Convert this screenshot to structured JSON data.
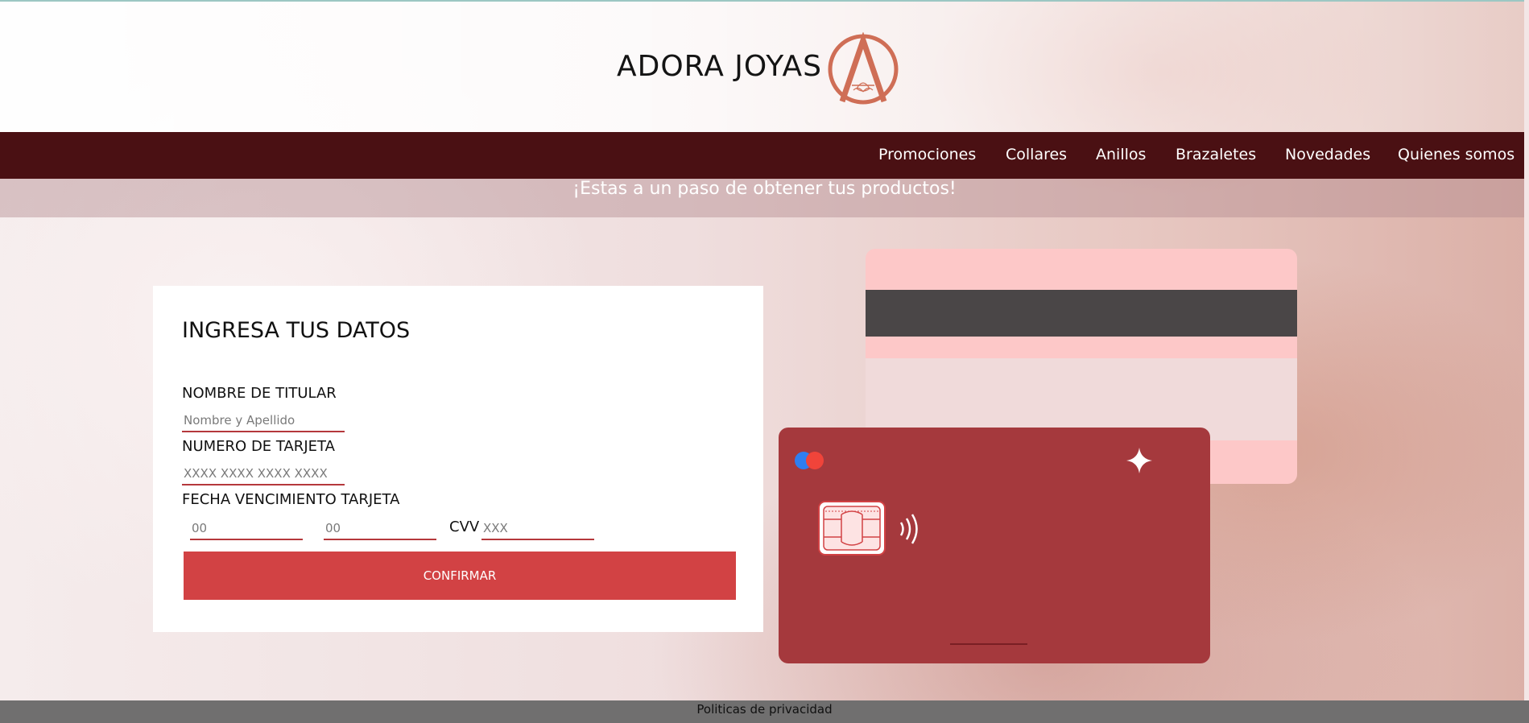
{
  "brand": {
    "name": "ADORA JOYAS",
    "logo_icon": "letter-a-lotus-logo",
    "accent": "#cf6e56"
  },
  "nav": {
    "items": [
      {
        "label": "Promociones"
      },
      {
        "label": "Collares"
      },
      {
        "label": "Anillos"
      },
      {
        "label": "Brazaletes"
      },
      {
        "label": "Novedades"
      },
      {
        "label": "Quienes somos"
      }
    ]
  },
  "banner": {
    "text": "¡Estas a un paso de obtener tus productos!"
  },
  "form": {
    "title": "INGRESA TUS DATOS",
    "holder_label": "NOMBRE DE TITULAR",
    "holder_placeholder": "Nombre y Apellido",
    "number_label": "NUMERO DE TARJETA",
    "number_placeholder": "XXXX XXXX XXXX XXXX",
    "expiry_label": "FECHA VENCIMIENTO TARJETA",
    "month_placeholder": "00",
    "year_placeholder": "00",
    "cvv_label": "CVV",
    "cvv_placeholder": "XXX",
    "confirm_label": "CONFIRMAR"
  },
  "card": {
    "brand_icon": "mastercard-circles-icon",
    "chip_icon": "chip-icon",
    "contactless_icon": "contactless-icon",
    "sparkle_icon": "sparkle-icon"
  },
  "footer": {
    "text": "Politicas de privacidad"
  },
  "colors": {
    "nav_bg": "#4a1013",
    "button": "#d24244",
    "card_front": "#a5393d",
    "card_back": "#fdc8c8"
  }
}
